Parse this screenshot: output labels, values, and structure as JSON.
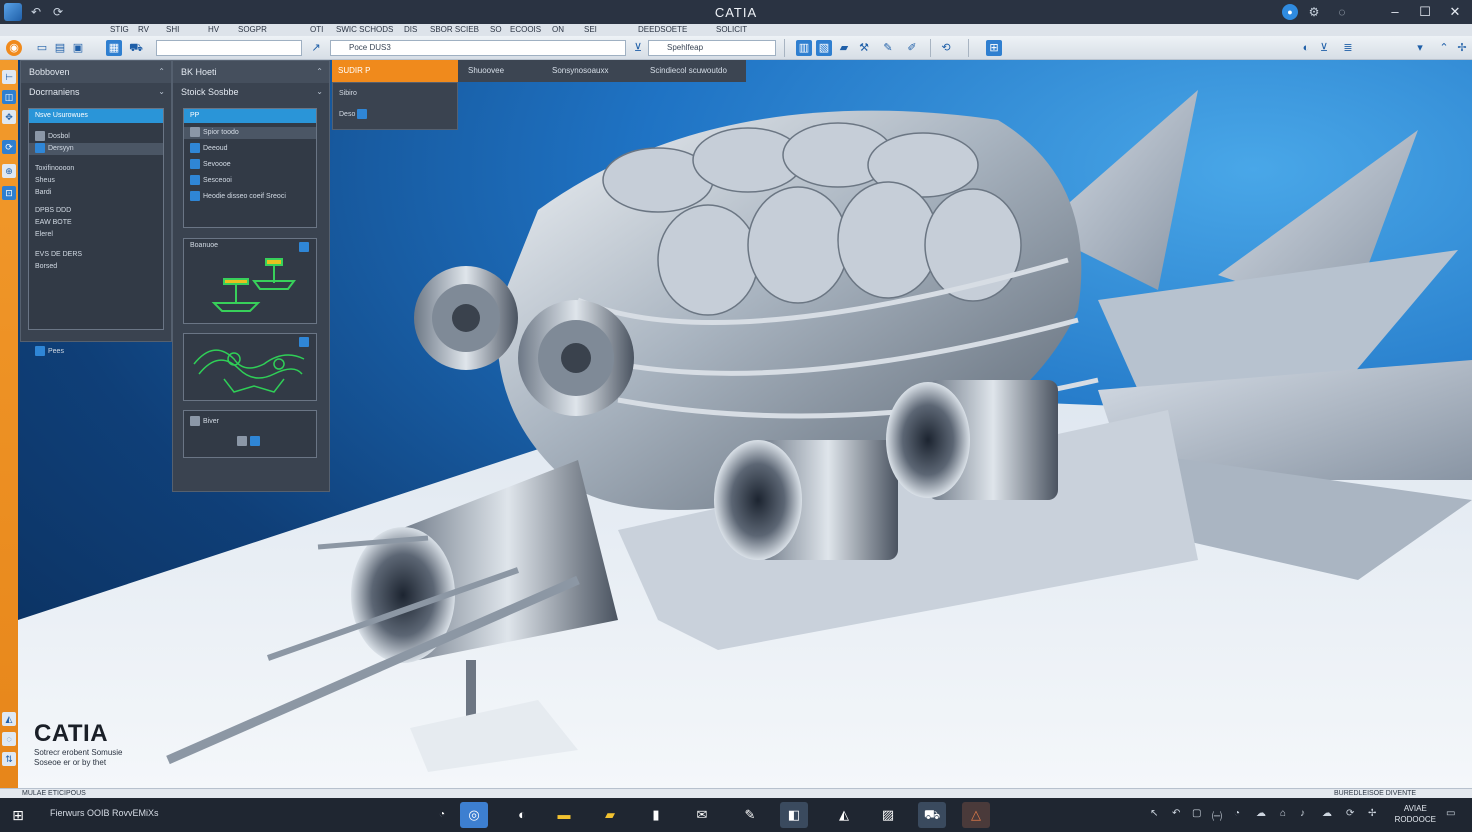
{
  "window": {
    "title": "CATIA"
  },
  "menu": {
    "items": [
      "STIG",
      "RV",
      "SHI",
      "HV",
      "SOGPR",
      "OTI",
      "SWIC SCHODS",
      "DIS",
      "SBOR SCIEB",
      "SO",
      "ECOOIS",
      "ON",
      "SEI",
      "DEEDSOETE",
      "SOLICIT"
    ]
  },
  "ribbon": {
    "field1": "",
    "field2": "Poce DUS3",
    "field3": "Spehlfeap"
  },
  "tabs": [
    {
      "label": "SUDIR P",
      "active": true
    },
    {
      "label": "Shuoovee",
      "active": false
    },
    {
      "label": "Sonsynosoauxx",
      "active": false
    },
    {
      "label": "Scindiecol scuwoutdo",
      "active": false
    }
  ],
  "panel1": {
    "header": "Bobboven",
    "subheader": "Docrnaniens",
    "box_title": "Nsve Usurowues",
    "rows": [
      "Dosbol",
      "Dersyyn",
      "Toxifinoooon",
      "Sheus",
      "Bardi",
      "DPBS DDD",
      "EAW BOTE",
      "Elerel",
      "EVS DE DERS",
      "Borsed"
    ],
    "footer_item": "Pees"
  },
  "panel2": {
    "header": "BK Hoeti",
    "subheader": "Stoick Sosbbe",
    "box_title": "PP",
    "items": [
      "Spior toodo",
      "Deeoud",
      "Sevoooe",
      "Sesceooi",
      "Heodie disseo coeif Sreoci"
    ],
    "thumb1_label": "Boanuoe",
    "thumb3_label": "Biver"
  },
  "panel3": {
    "label": "Sibiro",
    "row": "Deso"
  },
  "logo": {
    "brand": "CATIA",
    "line1": "Sotrecr erobent Somusie",
    "line2": "Soseoe er or by thet"
  },
  "statusbar": {
    "left": "MULAE ETICIPOUS",
    "right": "BUREDLEISOE DIVENTE"
  },
  "taskbar": {
    "search": "Fierwurs OOIB RovvEMiXs",
    "clock_time": "AVIAE",
    "clock_date": "RODOOCE"
  },
  "colors": {
    "accent_orange": "#f08a1c",
    "accent_blue": "#2a95d8",
    "panel_bg": "#3a4350",
    "titlebar": "#2a3342"
  }
}
